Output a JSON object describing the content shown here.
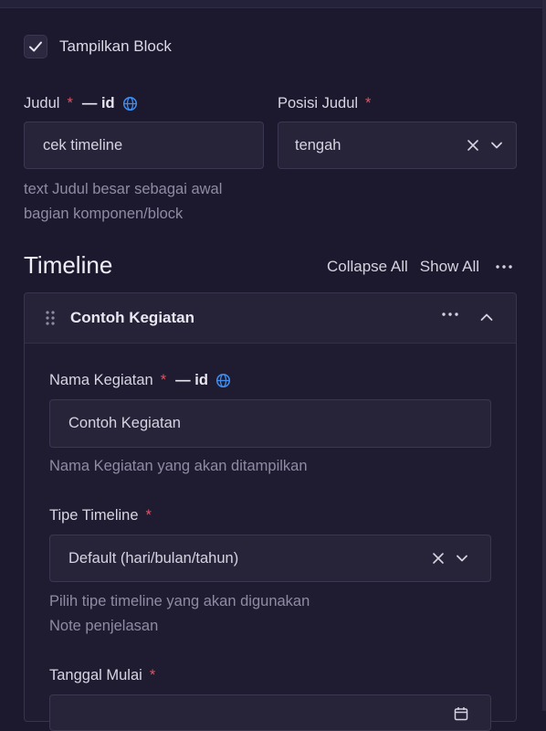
{
  "toggle": {
    "label": "Tampilkan Block",
    "checked": true
  },
  "judul": {
    "label": "Judul",
    "required_mark": "*",
    "locale_tag": "— id",
    "value": "cek timeline",
    "help_line1": "text Judul besar sebagai awal",
    "help_line2": "bagian komponen/block"
  },
  "posisi_judul": {
    "label": "Posisi Judul",
    "required_mark": "*",
    "value": "tengah"
  },
  "timeline": {
    "title": "Timeline",
    "collapse_all": "Collapse All",
    "show_all": "Show All"
  },
  "item": {
    "title": "Contoh Kegiatan",
    "nama_kegiatan": {
      "label": "Nama Kegiatan",
      "required_mark": "*",
      "locale_tag": "— id",
      "value": "Contoh Kegiatan",
      "help": "Nama Kegiatan yang akan ditampilkan"
    },
    "tipe_timeline": {
      "label": "Tipe Timeline",
      "required_mark": "*",
      "value": "Default (hari/bulan/tahun)",
      "help_line1": "Pilih tipe timeline yang akan digunakan",
      "help_line2": "Note penjelasan"
    },
    "tanggal_mulai": {
      "label": "Tanggal Mulai",
      "required_mark": "*"
    }
  },
  "colors": {
    "background": "#1c182e",
    "input_bg": "#27243a",
    "required": "#e05561",
    "globe": "#3d8ef0"
  }
}
